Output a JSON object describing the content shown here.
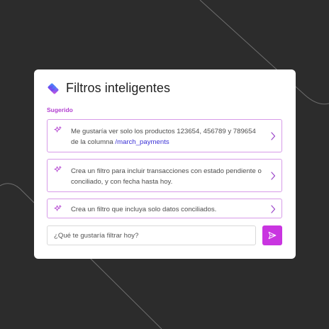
{
  "panel": {
    "title": "Filtros inteligentes",
    "section_label": "Sugerido"
  },
  "suggestions": [
    {
      "text": "Me gustaría ver solo los productos 123654, 456789 y 789654 de la columna ",
      "highlight": "/march_payments"
    },
    {
      "text": "Crea un filtro para incluir transacciones con estado pendiente o conciliado, y con fecha hasta hoy."
    },
    {
      "text": "Crea un filtro que incluya solo datos conciliados."
    }
  ],
  "search": {
    "placeholder": "¿Qué te gustaría filtrar hoy?",
    "value": ""
  },
  "icons": {
    "logo": "gradient-diamond-logo",
    "suggestion": "sparkle-icon",
    "chevron": "chevron-right-icon",
    "send": "send-icon"
  },
  "colors": {
    "background": "#2c2c2c",
    "card": "#ffffff",
    "accent": "#c935e0",
    "suggestion_border": "#d79be8",
    "link": "#3b32d6"
  }
}
